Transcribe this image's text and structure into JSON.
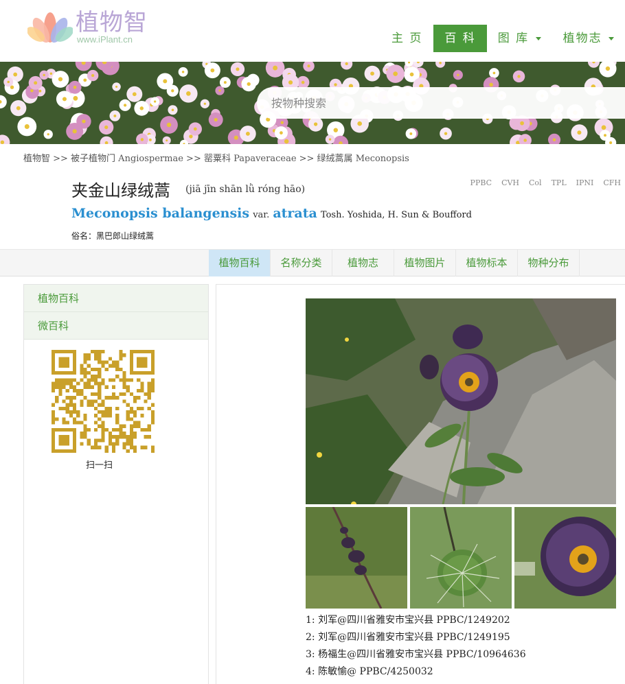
{
  "brand": {
    "name": "植物智",
    "url": "www.iPlant.cn"
  },
  "nav": {
    "items": [
      {
        "label": "主 页"
      },
      {
        "label": "百 科"
      },
      {
        "label": "图 库"
      },
      {
        "label": "植物志"
      }
    ]
  },
  "search": {
    "placeholder": "按物种搜索"
  },
  "breadcrumb": {
    "text": "植物智 >> 被子植物门 Angiospermae >> 罂粟科 Papaveraceae >> 绿绒蒿属 Meconopsis"
  },
  "species": {
    "name_cn": "夹金山绿绒蒿",
    "pinyin": "(jiā jīn shān lǜ róng hāo)",
    "genus_species": "Meconopsis balangensis",
    "rank": "var.",
    "infra_epithet": "atrata",
    "authors": "Tosh. Yoshida, H. Sun & Boufford",
    "common_name": "俗名：黑巴郎山绿绒蒿"
  },
  "external_links": [
    "PPBC",
    "CVH",
    "Col",
    "TPL",
    "IPNI",
    "CFH"
  ],
  "tabs": [
    {
      "label": "植物百科"
    },
    {
      "label": "名称分类"
    },
    {
      "label": "植物志"
    },
    {
      "label": "植物图片"
    },
    {
      "label": "植物标本"
    },
    {
      "label": "物种分布"
    }
  ],
  "sidebar": {
    "items": [
      {
        "label": "植物百科"
      },
      {
        "label": "微百科"
      }
    ],
    "qr_caption": "扫一扫"
  },
  "photo_credits": [
    "1:  刘军@四川省雅安市宝兴县 PPBC/1249202",
    "2:  刘军@四川省雅安市宝兴县 PPBC/1249195",
    "3:  杨福生@四川省雅安市宝兴县 PPBC/10964636",
    "4:  陈敏愉@ PPBC/4250032"
  ],
  "colors": {
    "brand_green": "#4a9a3a",
    "link_blue": "#2a8fd0",
    "active_tab": "#cfe6f6",
    "qr_gold": "#c9a02a"
  }
}
